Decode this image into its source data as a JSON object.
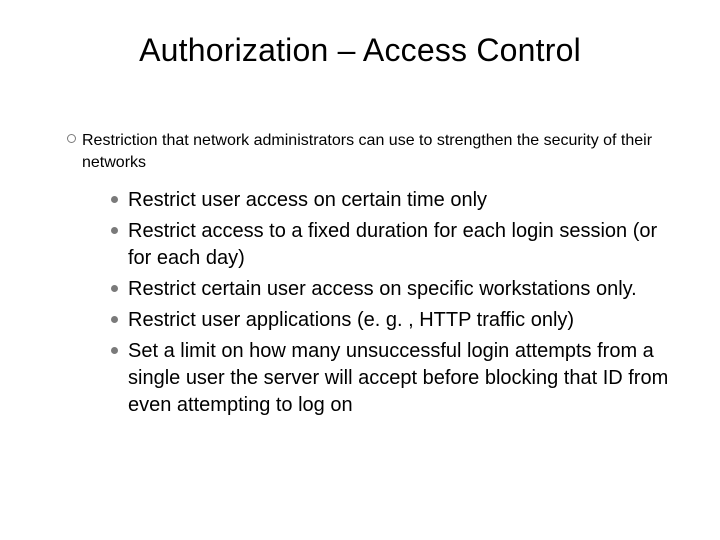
{
  "title": "Authorization –  Access Control",
  "intro": "Restriction that network administrators can use to strengthen the security of their networks",
  "points": {
    "p0": "Restrict user access on certain time only",
    "p1": "Restrict access to a fixed duration for each login session (or for each day)",
    "p2": "Restrict certain user access on specific workstations only.",
    "p3": "Restrict user applications (e. g. , HTTP traffic only)",
    "p4": "Set a limit on how many unsuccessful login attempts from a single user the server will accept before blocking that ID from even attempting to log on"
  }
}
